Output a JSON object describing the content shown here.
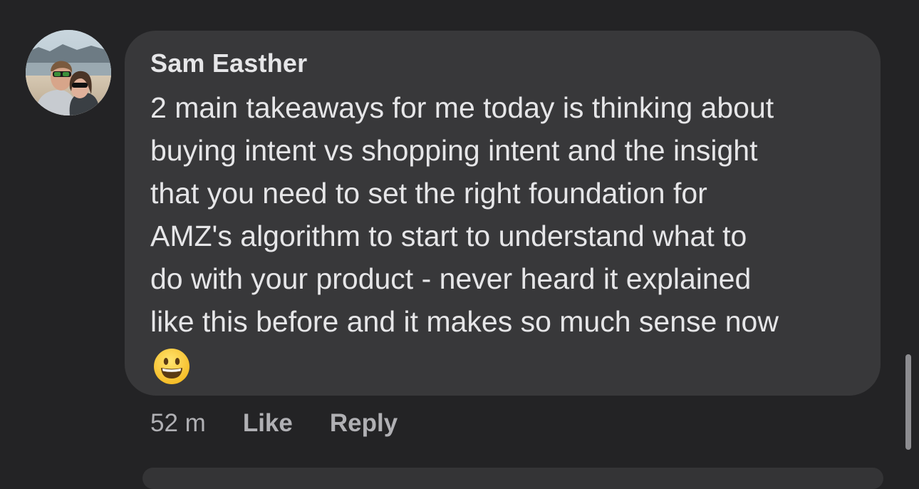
{
  "comment": {
    "author": "Sam Easther",
    "lines": [
      "2 main takeaways for me today is thinking about",
      "buying intent vs shopping intent and the insight",
      "that you need to set the right foundation for",
      "AMZ's algorithm to start to understand what to",
      "do with your product - never heard it explained",
      "like this before and it makes so much sense now"
    ],
    "emoji": "grinning-face-icon",
    "time": "52 m",
    "like_label": "Like",
    "reply_label": "Reply"
  },
  "colors": {
    "background": "#232325",
    "bubble": "#38383a",
    "text": "#e6e6e8",
    "meta_text": "#b0b0b4",
    "scrollbar": "#8d8d91"
  }
}
